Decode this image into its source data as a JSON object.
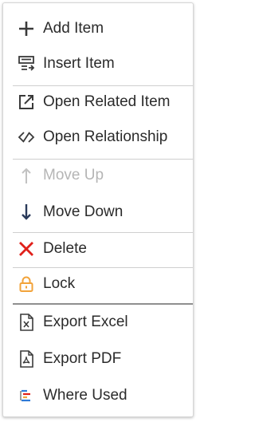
{
  "menu": {
    "items": [
      {
        "label": "Add Item",
        "icon": "plus-icon"
      },
      {
        "label": "Insert Item",
        "icon": "insert-list-icon"
      },
      {
        "label": "Open Related Item",
        "icon": "open-external-icon"
      },
      {
        "label": "Open Relationship",
        "icon": "relationship-link-icon"
      },
      {
        "label": "Move Up",
        "icon": "arrow-up-icon",
        "disabled": true
      },
      {
        "label": "Move Down",
        "icon": "arrow-down-icon"
      },
      {
        "label": "Delete",
        "icon": "delete-x-icon"
      },
      {
        "label": "Lock",
        "icon": "lock-icon"
      },
      {
        "label": "Export Excel",
        "icon": "excel-file-icon"
      },
      {
        "label": "Export PDF",
        "icon": "pdf-file-icon"
      },
      {
        "label": "Where Used",
        "icon": "where-used-icon"
      }
    ]
  },
  "colors": {
    "text": "#2b2b2b",
    "disabled_text": "#b5b5b5",
    "delete_red": "#e0201a",
    "lock_orange": "#f2a33a",
    "icon_dark": "#3a3a3a"
  }
}
